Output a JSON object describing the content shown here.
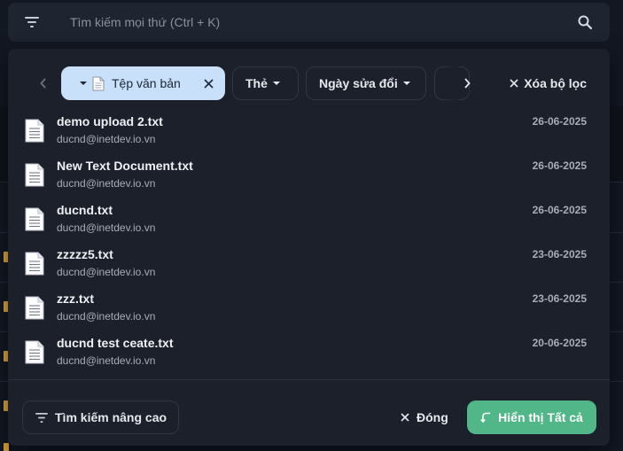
{
  "search": {
    "placeholder": "Tìm kiếm mọi thứ (Ctrl + K)",
    "value": ""
  },
  "filters": {
    "chips": [
      {
        "label": "Tệp văn bản",
        "active": true
      },
      {
        "label": "Thẻ",
        "active": false
      },
      {
        "label": "Ngày sửa đổi",
        "active": false
      }
    ],
    "clear_label": "Xóa bộ lọc"
  },
  "results": [
    {
      "name": "demo upload 2.txt",
      "owner": "ducnd@inetdev.io.vn",
      "date": "26-06-2025"
    },
    {
      "name": "New Text Document.txt",
      "owner": "ducnd@inetdev.io.vn",
      "date": "26-06-2025"
    },
    {
      "name": "ducnd.txt",
      "owner": "ducnd@inetdev.io.vn",
      "date": "26-06-2025"
    },
    {
      "name": "zzzzz5.txt",
      "owner": "ducnd@inetdev.io.vn",
      "date": "23-06-2025"
    },
    {
      "name": "zzz.txt",
      "owner": "ducnd@inetdev.io.vn",
      "date": "23-06-2025"
    },
    {
      "name": "ducnd test ceate.txt",
      "owner": "ducnd@inetdev.io.vn",
      "date": "20-06-2025"
    }
  ],
  "footer": {
    "advanced_search_label": "Tìm kiếm nâng cao",
    "close_label": "Đóng",
    "show_all_label": "Hiển thị Tất cả"
  },
  "colors": {
    "accent": "#52b788",
    "active_chip": "#c9e0fb",
    "panel": "#1b202b"
  },
  "icons": {
    "filter": "filter-icon",
    "search": "search-icon",
    "file": "text-file-icon",
    "close": "close-icon",
    "back": "undo-arrow-icon"
  }
}
